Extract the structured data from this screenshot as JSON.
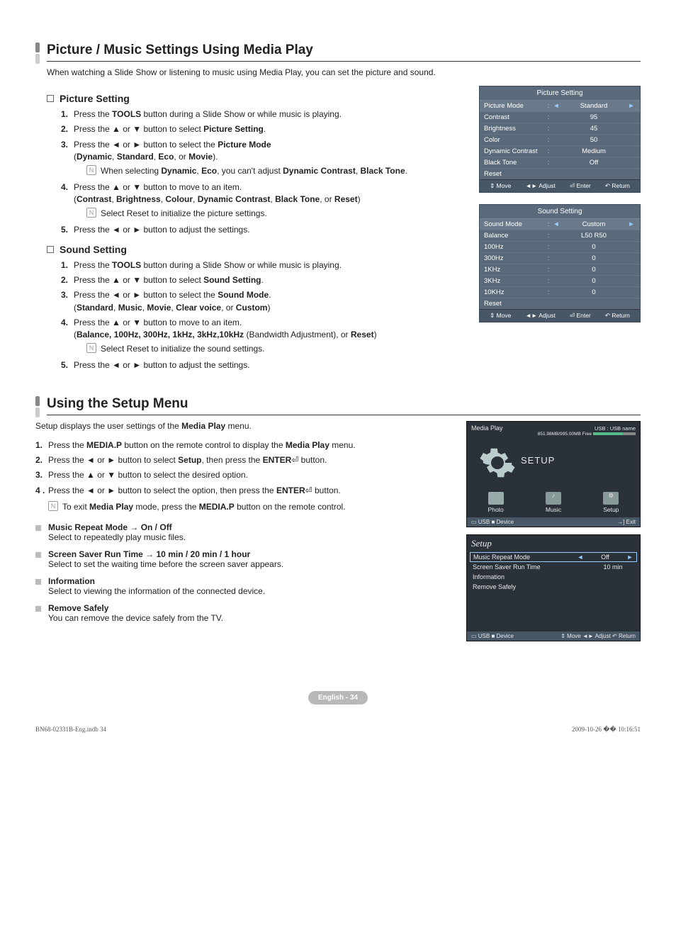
{
  "section1": {
    "title": "Picture / Music Settings Using Media Play",
    "intro": "When watching a Slide Show or listening to music using Media Play, you can set the picture and sound.",
    "picture": {
      "heading": "Picture Setting",
      "s1a": "Press the ",
      "s1b": "TOOLS",
      "s1c": " button during a Slide Show or while music is playing.",
      "s2a": "Press the ▲ or ▼ button to select ",
      "s2b": "Picture Setting",
      "s2c": ".",
      "s3a": "Press the ◄ or ► button to select the ",
      "s3b": "Picture Mode",
      "s3c": " (",
      "s3d": "Dynamic",
      "s3e": ", ",
      "s3f": "Standard",
      "s3g": ", ",
      "s3h": "Eco",
      "s3i": ", or ",
      "s3j": "Movie",
      "s3k": ").",
      "n3a": "When selecting ",
      "n3b": "Dynamic",
      "n3c": ", ",
      "n3d": "Eco",
      "n3e": ", you can't adjust ",
      "n3f": "Dynamic Contrast",
      "n3g": ", ",
      "n3h": "Black Tone",
      "n3i": ".",
      "s4a": "Press the ▲ or ▼ button to move to an item.",
      "s4b": "(",
      "s4c": "Contrast",
      "s4d": ", ",
      "s4e": "Brightness",
      "s4f": ", ",
      "s4g": "Colour",
      "s4h": ", ",
      "s4i": "Dynamic Contrast",
      "s4j": ", ",
      "s4k": "Black Tone",
      "s4l": ", or ",
      "s4m": "Reset",
      "s4n": ")",
      "n4": "Select Reset to initialize the picture settings.",
      "s5": "Press the ◄ or ► button to adjust the settings."
    },
    "sound": {
      "heading": "Sound Setting",
      "s1a": "Press the ",
      "s1b": "TOOLS",
      "s1c": " button during a Slide Show or while music is playing.",
      "s2a": "Press the ▲ or ▼ button to select ",
      "s2b": "Sound Setting",
      "s2c": ".",
      "s3a": "Press the ◄ or ► button to select the ",
      "s3b": "Sound Mode",
      "s3c": ".",
      "s3d": "(",
      "s3e": "Standard",
      "s3f": ", ",
      "s3g": "Music",
      "s3h": ", ",
      "s3i": "Movie",
      "s3j": ", ",
      "s3k": "Clear voice",
      "s3l": ", or ",
      "s3m": "Custom",
      "s3n": ")",
      "s4a": "Press the ▲ or ▼ button to move to an item.",
      "s4b": "(",
      "s4c": "Balance, 100Hz, 300Hz, 1kHz, 3kHz,10kHz",
      "s4d": " (Bandwidth Adjustment), or ",
      "s4e": "Reset",
      "s4f": ")",
      "n4": "Select Reset to initialize the sound settings.",
      "s5": "Press the ◄ or ► button to adjust the settings."
    }
  },
  "osd_picture": {
    "title": "Picture Setting",
    "rows": [
      {
        "label": "Picture Mode",
        "val": "Standard",
        "sel": true,
        "arrows": true
      },
      {
        "label": "Contrast",
        "val": "95"
      },
      {
        "label": "Brightness",
        "val": "45"
      },
      {
        "label": "Color",
        "val": "50"
      },
      {
        "label": "Dynamic Contrast",
        "val": "Medium"
      },
      {
        "label": "Black Tone",
        "val": "Off"
      },
      {
        "label": "Reset",
        "val": ""
      }
    ],
    "footer": {
      "move": "Move",
      "adjust": "Adjust",
      "enter": "Enter",
      "return": "Return"
    }
  },
  "osd_sound": {
    "title": "Sound Setting",
    "rows": [
      {
        "label": "Sound Mode",
        "val": "Custom",
        "sel": true,
        "arrows": true
      },
      {
        "label": "Balance",
        "val": "L50 R50"
      },
      {
        "label": "100Hz",
        "val": "0"
      },
      {
        "label": "300Hz",
        "val": "0"
      },
      {
        "label": "1KHz",
        "val": "0"
      },
      {
        "label": "3KHz",
        "val": "0"
      },
      {
        "label": "10KHz",
        "val": "0"
      },
      {
        "label": "Reset",
        "val": ""
      }
    ],
    "footer": {
      "move": "Move",
      "adjust": "Adjust",
      "enter": "Enter",
      "return": "Return"
    }
  },
  "section2": {
    "title": "Using the Setup Menu",
    "introA": "Setup displays the user settings of the ",
    "introB": "Media Play",
    "introC": " menu.",
    "s1a": "Press the ",
    "s1b": "MEDIA.P",
    "s1c": " button on the remote control to display the ",
    "s1d": "Media Play",
    "s1e": " menu.",
    "s2a": "Press the ◄ or ► button to select ",
    "s2b": "Setup",
    "s2c": ", then press the ",
    "s2d": "ENTER",
    "s2e": " button.",
    "s3": "Press the ▲ or ▼ button to select the desired option.",
    "s4a": "Press the ◄ or ► button to select the option, then press the ",
    "s4b": "ENTER",
    "s4c": " button.",
    "noteA": "To exit ",
    "noteB": "Media Play",
    "noteC": " mode, press the ",
    "noteD": "MEDIA.P",
    "noteE": " button on the remote control.",
    "items": {
      "i1t": "Music Repeat Mode → On / Off",
      "i1d": "Select to repeatedly play music files.",
      "i2t": "Screen Saver Run Time → 10 min / 20 min / 1 hour",
      "i2d": "Select to set the waiting time before the screen saver appears.",
      "i3t": "Information",
      "i3d": "Select to viewing the information of the connected device.",
      "i4t": "Remove Safely",
      "i4d": "You can remove the device safely from the TV."
    }
  },
  "mediaplay": {
    "title": "Media Play",
    "usb": "USB : USB name",
    "free": "851.98MB/995.00MB Free",
    "setup_big": "SETUP",
    "photo": "Photo",
    "music": "Music",
    "setup": "Setup",
    "bar_usb": "USB",
    "bar_device": "Device",
    "bar_exit": "Exit"
  },
  "setup_osd": {
    "title": "Setup",
    "rows": [
      {
        "label": "Music Repeat Mode",
        "val": "Off",
        "sel": true,
        "arrows": true
      },
      {
        "label": "Screen Saver Run Time",
        "val": "10 min"
      },
      {
        "label": "Information",
        "val": ""
      },
      {
        "label": "Remove Safely",
        "val": ""
      }
    ],
    "bar_usb": "USB",
    "bar_device": "Device",
    "bar_move": "Move",
    "bar_adjust": "Adjust",
    "bar_return": "Return"
  },
  "footer": {
    "badge": "English - 34",
    "left": "BN68-02331B-Eng.indb   34",
    "right": "2009-10-26   �� 10:16:51"
  },
  "enter_glyph": "⏎",
  "note_glyph": "N"
}
